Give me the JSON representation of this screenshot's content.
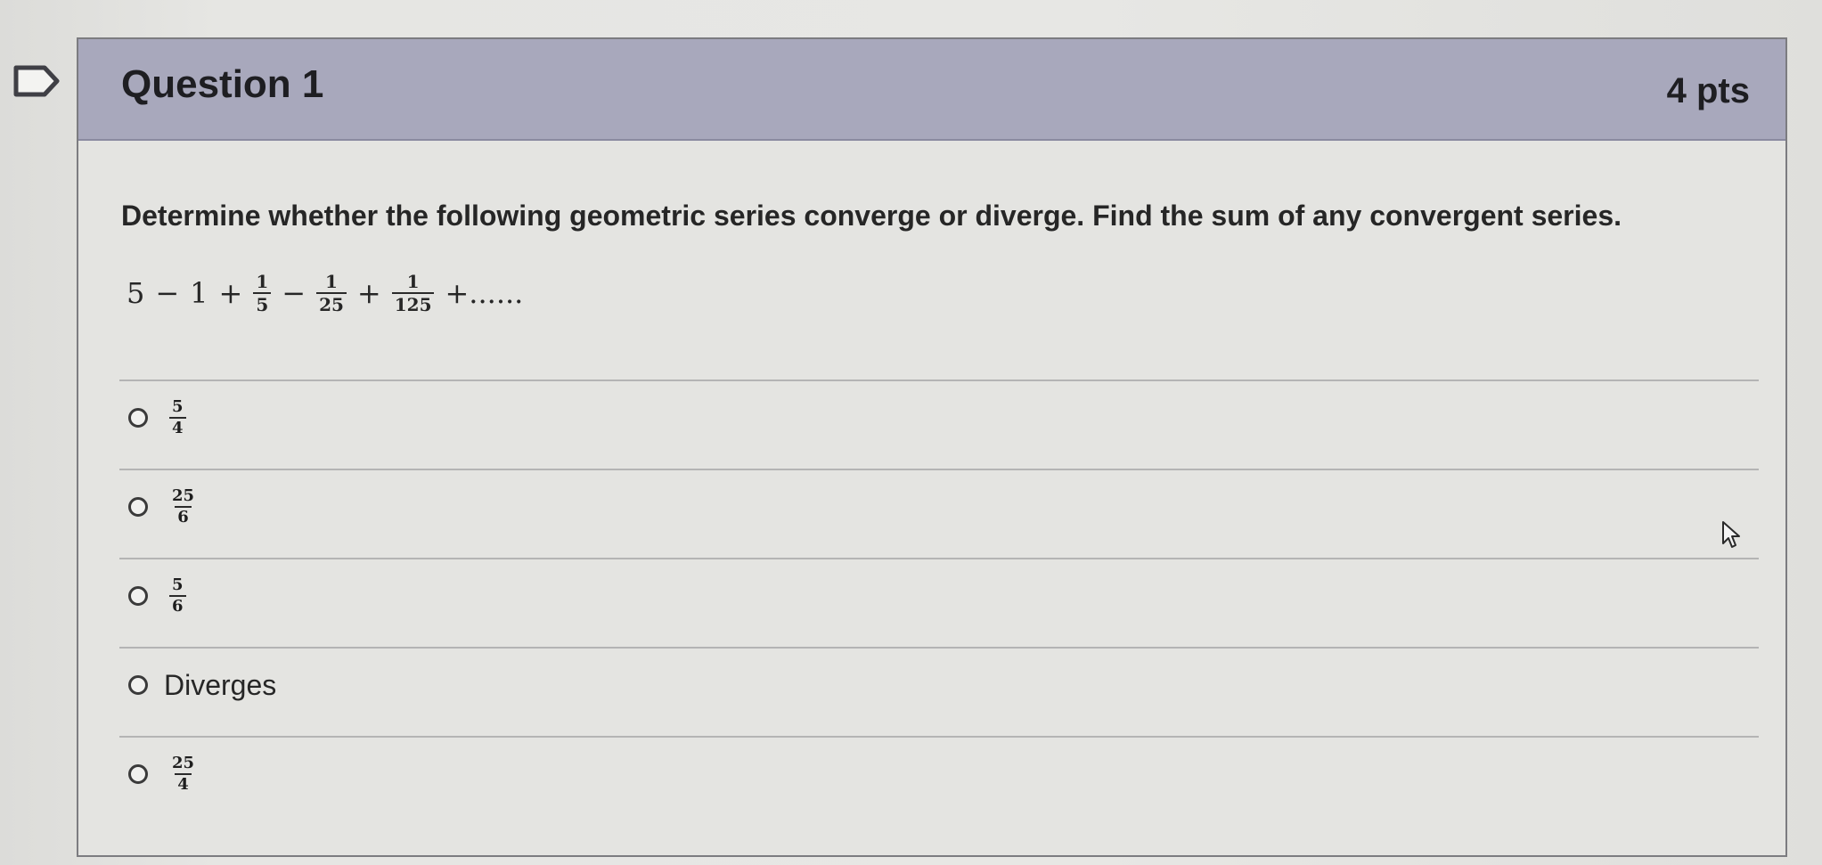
{
  "question": {
    "title": "Question 1",
    "points": "4 pts",
    "prompt": "Determine whether the following geometric series converge or diverge.  Find the sum of any convergent series.",
    "series": {
      "t1": "5",
      "op1": "−",
      "t2": "1",
      "op2": "+",
      "f1_num": "1",
      "f1_den": "5",
      "op3": "−",
      "f2_num": "1",
      "f2_den": "25",
      "op4": "+",
      "f3_num": "1",
      "f3_den": "125",
      "tail": "+......"
    }
  },
  "options": [
    {
      "num": "5",
      "den": "4"
    },
    {
      "num": "25",
      "den": "6"
    },
    {
      "num": "5",
      "den": "6"
    },
    {
      "label": "Diverges"
    },
    {
      "num": "25",
      "den": "4"
    }
  ],
  "icons": {
    "flag": "flag-icon",
    "radio": "radio-icon",
    "cursor": "mouse-pointer-icon"
  }
}
